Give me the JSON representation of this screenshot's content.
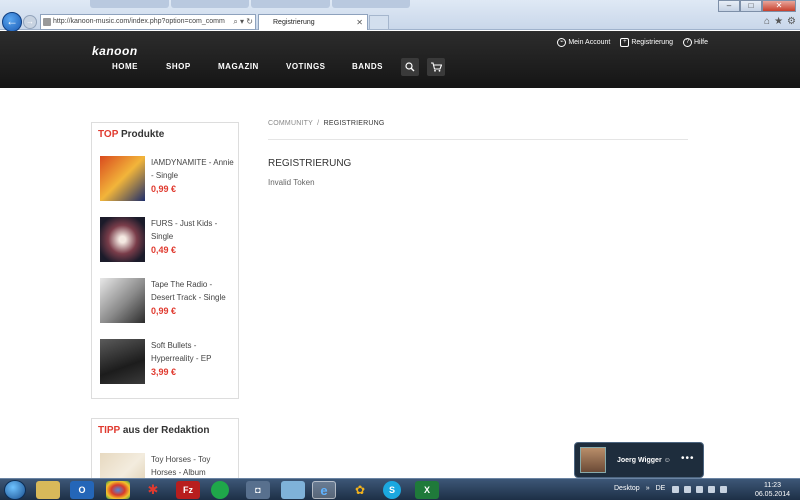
{
  "browser": {
    "url": "http://kanoon-music.com/index.php?option=com_comm",
    "tab_title": "Registrierung"
  },
  "site": {
    "logo": "kanoon",
    "nav": [
      "HOME",
      "SHOP",
      "MAGAZIN",
      "VOTINGS",
      "BANDS"
    ],
    "account_links": [
      "Mein Account",
      "Registrierung",
      "Hilfe"
    ]
  },
  "sidebar": {
    "top_title_highlight": "TOP",
    "top_title_rest": " Produkte",
    "products": [
      {
        "title": "IAMDYNAMITE - Annie - Single",
        "price": "0,99 €"
      },
      {
        "title": "FURS - Just Kids - Single",
        "price": "0,49 €"
      },
      {
        "title": "Tape The Radio - Desert Track - Single",
        "price": "0,99 €"
      },
      {
        "title": "Soft Bullets - Hyperreality - EP",
        "price": "3,99 €"
      }
    ],
    "tipp_title_highlight": "TIPP",
    "tipp_title_rest": " aus der Redaktion",
    "tipp_product": {
      "title": "Toy Horses - Toy Horses - Album"
    }
  },
  "main": {
    "breadcrumb_parent": "COMMUNITY",
    "breadcrumb_sep": "/",
    "breadcrumb_current": "REGISTRIERUNG",
    "title": "REGISTRIERUNG",
    "message": "Invalid Token"
  },
  "skype": {
    "name": "Joerg Wigger ☺"
  },
  "taskbar": {
    "desktop_label": "Desktop",
    "lang": "DE",
    "time": "11:23",
    "date": "06.05.2014"
  },
  "colors": {
    "accent": "#e03a2f",
    "header_bg": "#1e1e1e"
  }
}
